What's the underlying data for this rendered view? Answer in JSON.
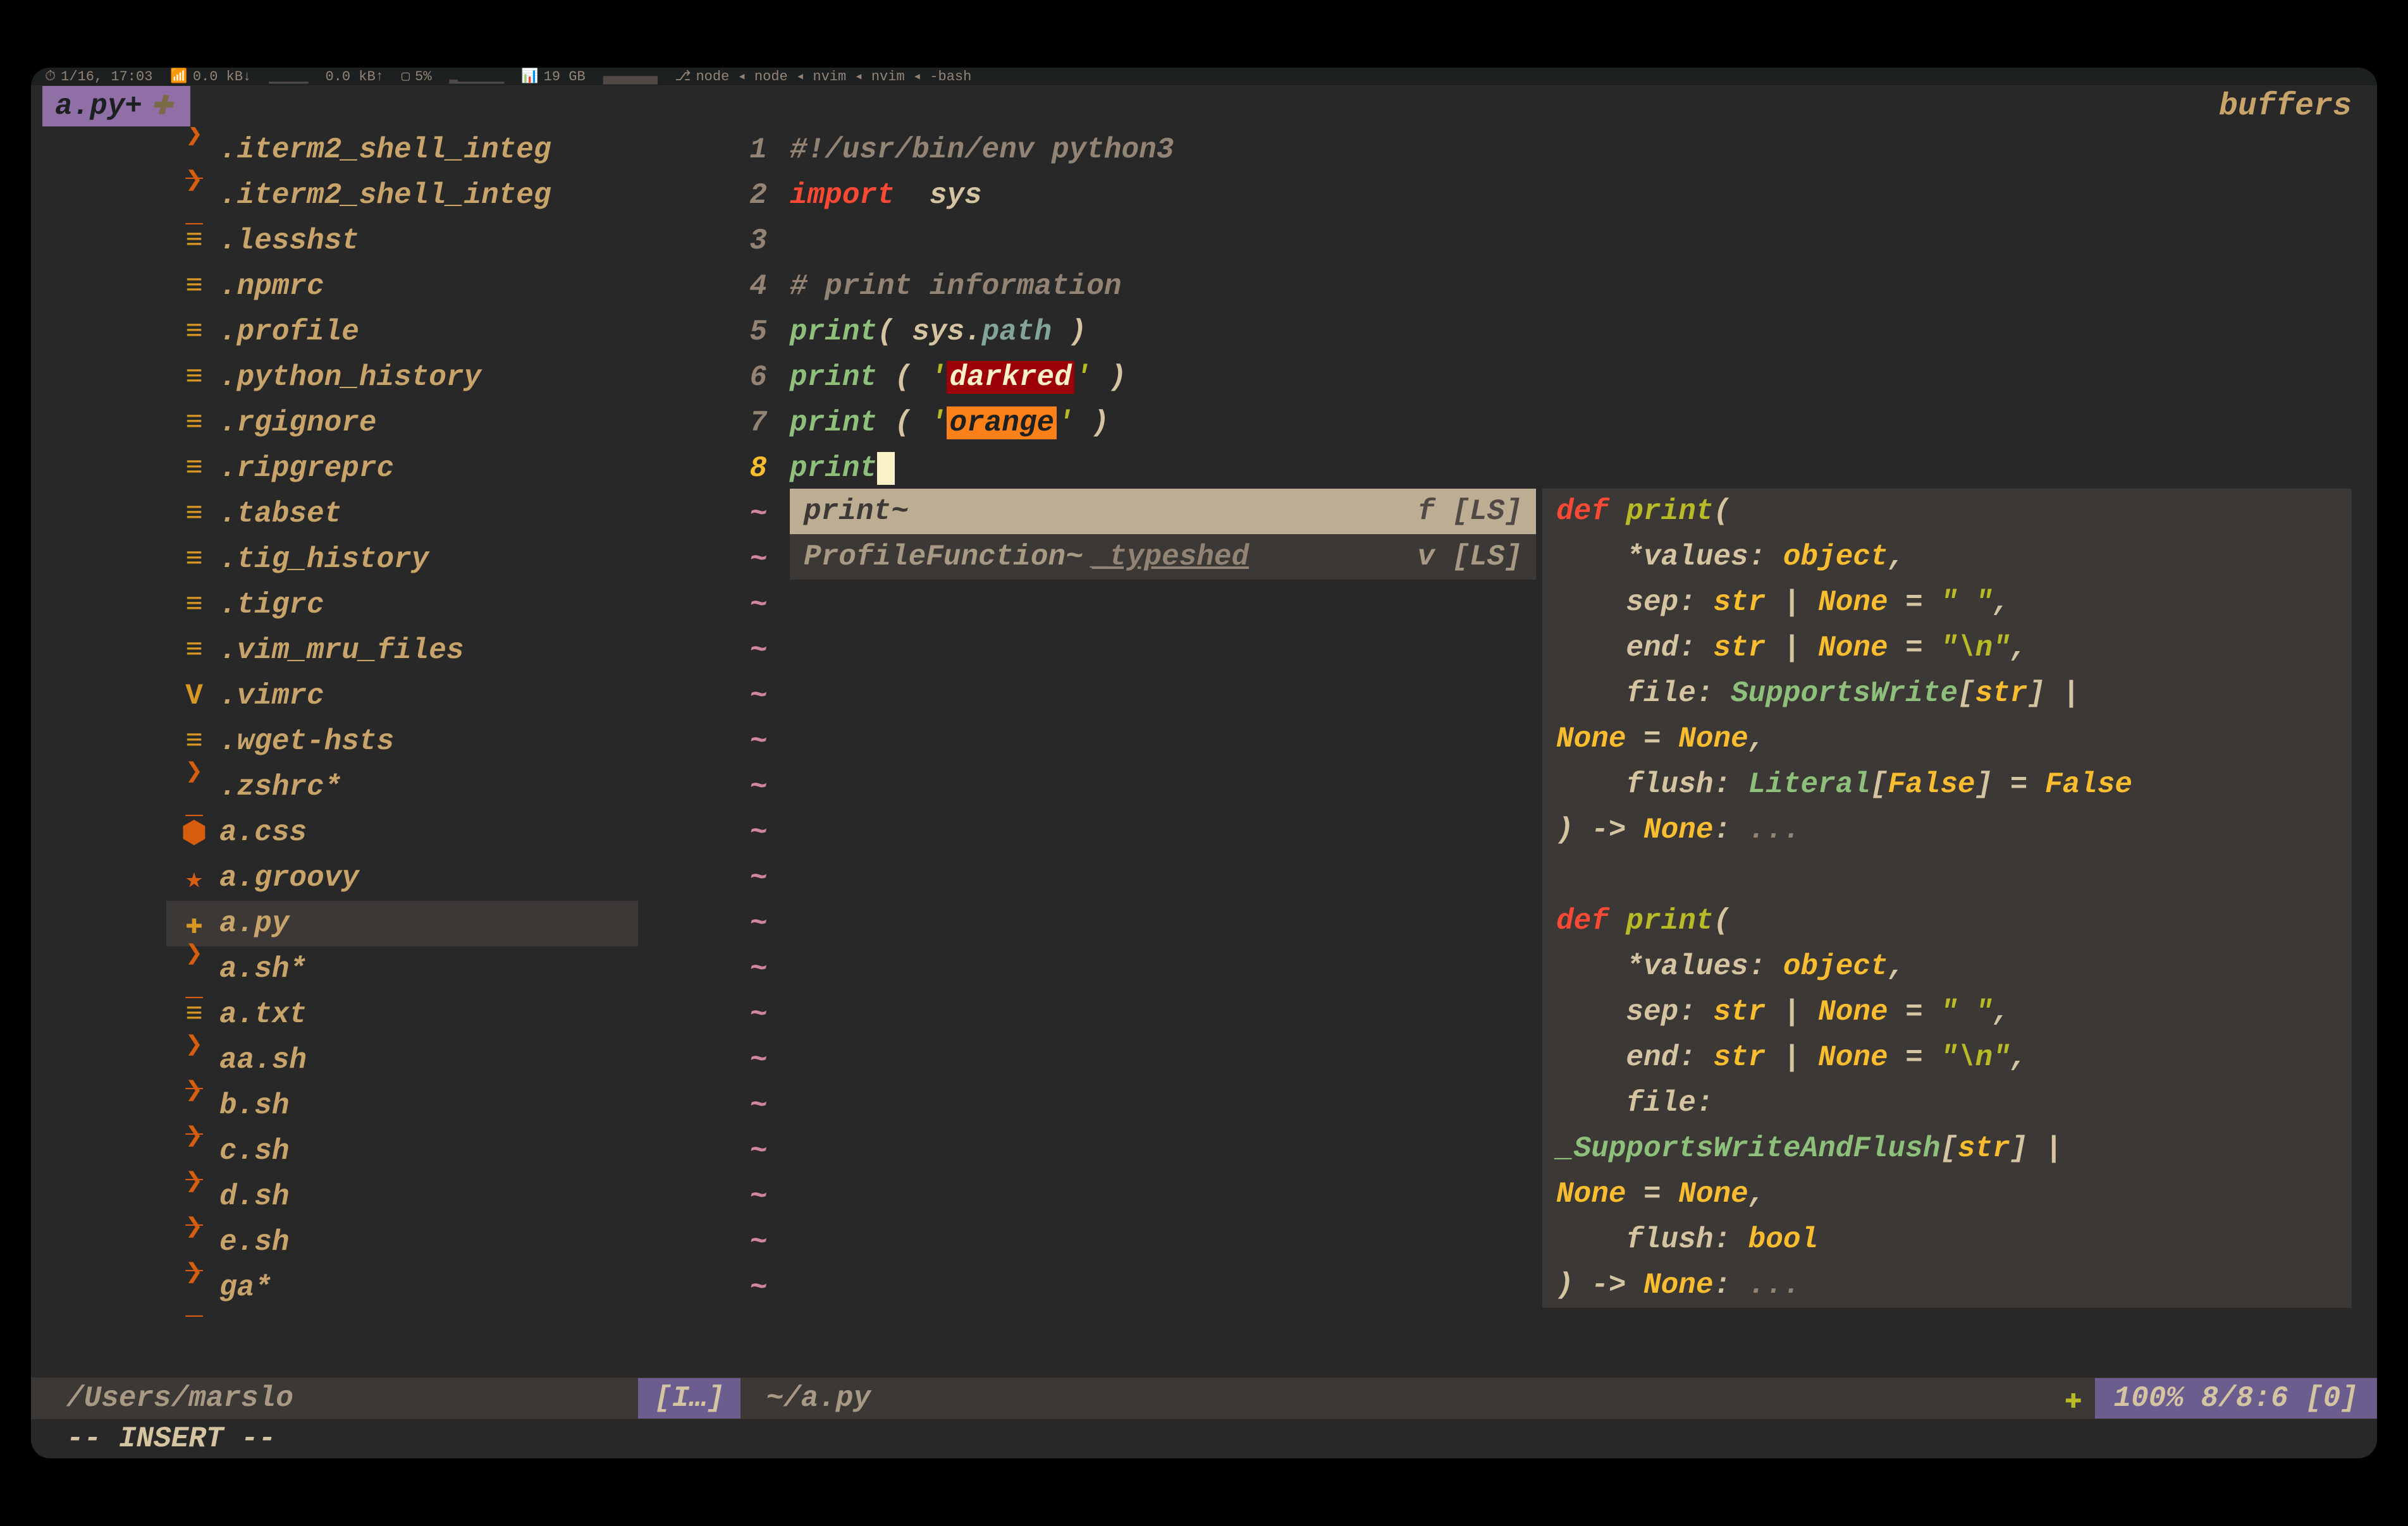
{
  "menubar": {
    "time": "1/16, 17:03",
    "net_down": "0.0 kB↓",
    "net_up": "0.0 kB↑",
    "cpu": "5%",
    "ram": "19 GB",
    "procs": "node ◂ node ◂ nvim ◂ nvim ◂ -bash"
  },
  "tabs": {
    "active": "a.py+",
    "right_label": "buffers"
  },
  "sidebar": {
    "items": [
      {
        "icon": "term",
        "glyph": "❯_",
        "label": ".iterm2_shell_integ"
      },
      {
        "icon": "term",
        "glyph": "❯_",
        "label": ".iterm2_shell_integ"
      },
      {
        "icon": "file",
        "glyph": "≡",
        "label": ".lesshst"
      },
      {
        "icon": "file",
        "glyph": "≡",
        "label": ".npmrc"
      },
      {
        "icon": "file",
        "glyph": "≡",
        "label": ".profile"
      },
      {
        "icon": "file",
        "glyph": "≡",
        "label": ".python_history"
      },
      {
        "icon": "file",
        "glyph": "≡",
        "label": ".rgignore"
      },
      {
        "icon": "file",
        "glyph": "≡",
        "label": ".ripgreprc"
      },
      {
        "icon": "file",
        "glyph": "≡",
        "label": ".tabset"
      },
      {
        "icon": "file",
        "glyph": "≡",
        "label": ".tig_history"
      },
      {
        "icon": "file",
        "glyph": "≡",
        "label": ".tigrc"
      },
      {
        "icon": "file",
        "glyph": "≡",
        "label": ".vim_mru_files"
      },
      {
        "icon": "vim",
        "glyph": "V",
        "label": ".vimrc"
      },
      {
        "icon": "file",
        "glyph": "≡",
        "label": ".wget-hsts"
      },
      {
        "icon": "term",
        "glyph": "❯_",
        "label": ".zshrc*"
      },
      {
        "icon": "css",
        "glyph": "⬢",
        "label": "a.css"
      },
      {
        "icon": "star",
        "glyph": "★",
        "label": "a.groovy"
      },
      {
        "icon": "py",
        "glyph": "✚",
        "label": "a.py",
        "active": true
      },
      {
        "icon": "term",
        "glyph": "❯_",
        "label": "a.sh*"
      },
      {
        "icon": "file",
        "glyph": "≡",
        "label": "a.txt"
      },
      {
        "icon": "term",
        "glyph": "❯_",
        "label": "aa.sh"
      },
      {
        "icon": "term",
        "glyph": "❯_",
        "label": "b.sh"
      },
      {
        "icon": "term",
        "glyph": "❯_",
        "label": "c.sh"
      },
      {
        "icon": "term",
        "glyph": "❯_",
        "label": "d.sh"
      },
      {
        "icon": "term",
        "glyph": "❯_",
        "label": "e.sh"
      },
      {
        "icon": "term",
        "glyph": "❯_",
        "label": "ga*"
      }
    ]
  },
  "editor": {
    "lines": [
      {
        "n": "1",
        "tokens": [
          {
            "c": "tok-comment",
            "t": "#!/usr/bin/env python3"
          }
        ]
      },
      {
        "n": "2",
        "tokens": [
          {
            "c": "tok-kw",
            "t": "import"
          },
          {
            "c": "tok-id",
            "t": "  sys"
          }
        ]
      },
      {
        "n": "3",
        "tokens": []
      },
      {
        "n": "4",
        "tokens": [
          {
            "c": "tok-comment",
            "t": "# print information"
          }
        ]
      },
      {
        "n": "5",
        "tokens": [
          {
            "c": "tok-fn",
            "t": "print"
          },
          {
            "c": "tok-punct",
            "t": "( "
          },
          {
            "c": "tok-id",
            "t": "sys"
          },
          {
            "c": "tok-punct",
            "t": "."
          },
          {
            "c": "tok-path",
            "t": "path"
          },
          {
            "c": "tok-punct",
            "t": " )"
          }
        ]
      },
      {
        "n": "6",
        "tokens": [
          {
            "c": "tok-fn",
            "t": "print"
          },
          {
            "c": "tok-punct",
            "t": " ( "
          },
          {
            "c": "tok-str",
            "t": "'"
          },
          {
            "c": "hl-darkred",
            "t": "darkred"
          },
          {
            "c": "tok-str",
            "t": "'"
          },
          {
            "c": "tok-punct",
            "t": " )"
          }
        ]
      },
      {
        "n": "7",
        "tokens": [
          {
            "c": "tok-fn",
            "t": "print"
          },
          {
            "c": "tok-punct",
            "t": " ( "
          },
          {
            "c": "tok-str",
            "t": "'"
          },
          {
            "c": "hl-orange",
            "t": "orange"
          },
          {
            "c": "tok-str",
            "t": "'"
          },
          {
            "c": "tok-punct",
            "t": " )"
          }
        ]
      },
      {
        "n": "8",
        "cur": true,
        "tokens": [
          {
            "c": "tok-fn",
            "t": "print"
          },
          {
            "c": "cursor",
            "t": " "
          }
        ]
      }
    ],
    "tilde_count": 18
  },
  "completion": {
    "items": [
      {
        "label": "print~",
        "kind": "f",
        "src": "[LS]",
        "selected": true
      },
      {
        "label": "ProfileFunction~",
        "extra": "_typeshed",
        "kind": "v",
        "src": "[LS]"
      }
    ]
  },
  "doc": {
    "lines": [
      [
        {
          "c": "d-def",
          "t": "def "
        },
        {
          "c": "d-fn",
          "t": "print"
        },
        {
          "c": "d-punct",
          "t": "("
        }
      ],
      [
        {
          "c": "d-punct",
          "t": "    *"
        },
        {
          "c": "d-param",
          "t": "values"
        },
        {
          "c": "d-punct",
          "t": ": "
        },
        {
          "c": "d-type",
          "t": "object"
        },
        {
          "c": "d-punct",
          "t": ","
        }
      ],
      [
        {
          "c": "d-punct",
          "t": "    "
        },
        {
          "c": "d-param",
          "t": "sep"
        },
        {
          "c": "d-punct",
          "t": ": "
        },
        {
          "c": "d-type",
          "t": "str"
        },
        {
          "c": "d-punct",
          "t": " | "
        },
        {
          "c": "d-none",
          "t": "None"
        },
        {
          "c": "d-punct",
          "t": " = "
        },
        {
          "c": "d-str",
          "t": "\" \""
        },
        {
          "c": "d-punct",
          "t": ","
        }
      ],
      [
        {
          "c": "d-punct",
          "t": "    "
        },
        {
          "c": "d-param",
          "t": "end"
        },
        {
          "c": "d-punct",
          "t": ": "
        },
        {
          "c": "d-type",
          "t": "str"
        },
        {
          "c": "d-punct",
          "t": " | "
        },
        {
          "c": "d-none",
          "t": "None"
        },
        {
          "c": "d-punct",
          "t": " = "
        },
        {
          "c": "d-str",
          "t": "\"\\n\""
        },
        {
          "c": "d-punct",
          "t": ","
        }
      ],
      [
        {
          "c": "d-punct",
          "t": "    "
        },
        {
          "c": "d-param",
          "t": "file"
        },
        {
          "c": "d-punct",
          "t": ": "
        },
        {
          "c": "d-type2",
          "t": "SupportsWrite"
        },
        {
          "c": "d-punct",
          "t": "["
        },
        {
          "c": "d-type",
          "t": "str"
        },
        {
          "c": "d-punct",
          "t": "] |"
        }
      ],
      [
        {
          "c": "d-none",
          "t": "None"
        },
        {
          "c": "d-punct",
          "t": " = "
        },
        {
          "c": "d-none",
          "t": "None"
        },
        {
          "c": "d-punct",
          "t": ","
        }
      ],
      [
        {
          "c": "d-punct",
          "t": "    "
        },
        {
          "c": "d-param",
          "t": "flush"
        },
        {
          "c": "d-punct",
          "t": ": "
        },
        {
          "c": "d-type2",
          "t": "Literal"
        },
        {
          "c": "d-punct",
          "t": "["
        },
        {
          "c": "d-none",
          "t": "False"
        },
        {
          "c": "d-punct",
          "t": "] = "
        },
        {
          "c": "d-none",
          "t": "False"
        }
      ],
      [
        {
          "c": "d-punct",
          "t": ") -> "
        },
        {
          "c": "d-none",
          "t": "None"
        },
        {
          "c": "d-punct",
          "t": ": "
        },
        {
          "c": "d-dots",
          "t": "..."
        }
      ],
      [],
      [
        {
          "c": "d-def",
          "t": "def "
        },
        {
          "c": "d-fn",
          "t": "print"
        },
        {
          "c": "d-punct",
          "t": "("
        }
      ],
      [
        {
          "c": "d-punct",
          "t": "    *"
        },
        {
          "c": "d-param",
          "t": "values"
        },
        {
          "c": "d-punct",
          "t": ": "
        },
        {
          "c": "d-type",
          "t": "object"
        },
        {
          "c": "d-punct",
          "t": ","
        }
      ],
      [
        {
          "c": "d-punct",
          "t": "    "
        },
        {
          "c": "d-param",
          "t": "sep"
        },
        {
          "c": "d-punct",
          "t": ": "
        },
        {
          "c": "d-type",
          "t": "str"
        },
        {
          "c": "d-punct",
          "t": " | "
        },
        {
          "c": "d-none",
          "t": "None"
        },
        {
          "c": "d-punct",
          "t": " = "
        },
        {
          "c": "d-str",
          "t": "\" \""
        },
        {
          "c": "d-punct",
          "t": ","
        }
      ],
      [
        {
          "c": "d-punct",
          "t": "    "
        },
        {
          "c": "d-param",
          "t": "end"
        },
        {
          "c": "d-punct",
          "t": ": "
        },
        {
          "c": "d-type",
          "t": "str"
        },
        {
          "c": "d-punct",
          "t": " | "
        },
        {
          "c": "d-none",
          "t": "None"
        },
        {
          "c": "d-punct",
          "t": " = "
        },
        {
          "c": "d-str",
          "t": "\"\\n\""
        },
        {
          "c": "d-punct",
          "t": ","
        }
      ],
      [
        {
          "c": "d-punct",
          "t": "    "
        },
        {
          "c": "d-param",
          "t": "file"
        },
        {
          "c": "d-punct",
          "t": ":"
        }
      ],
      [
        {
          "c": "d-type2",
          "t": "_SupportsWriteAndFlush"
        },
        {
          "c": "d-punct",
          "t": "["
        },
        {
          "c": "d-type",
          "t": "str"
        },
        {
          "c": "d-punct",
          "t": "] |"
        }
      ],
      [
        {
          "c": "d-none",
          "t": "None"
        },
        {
          "c": "d-punct",
          "t": " = "
        },
        {
          "c": "d-none",
          "t": "None"
        },
        {
          "c": "d-punct",
          "t": ","
        }
      ],
      [
        {
          "c": "d-punct",
          "t": "    "
        },
        {
          "c": "d-param",
          "t": "flush"
        },
        {
          "c": "d-punct",
          "t": ": "
        },
        {
          "c": "d-type",
          "t": "bool"
        }
      ],
      [
        {
          "c": "d-punct",
          "t": ") -> "
        },
        {
          "c": "d-none",
          "t": "None"
        },
        {
          "c": "d-punct",
          "t": ": "
        },
        {
          "c": "d-dots",
          "t": "..."
        }
      ]
    ]
  },
  "statusbar": {
    "cwd": "/Users/marslo",
    "mode": "[I…]",
    "file": "~/a.py",
    "pos": "100% 8/8:6 [0]"
  },
  "cmdline": "-- INSERT --"
}
